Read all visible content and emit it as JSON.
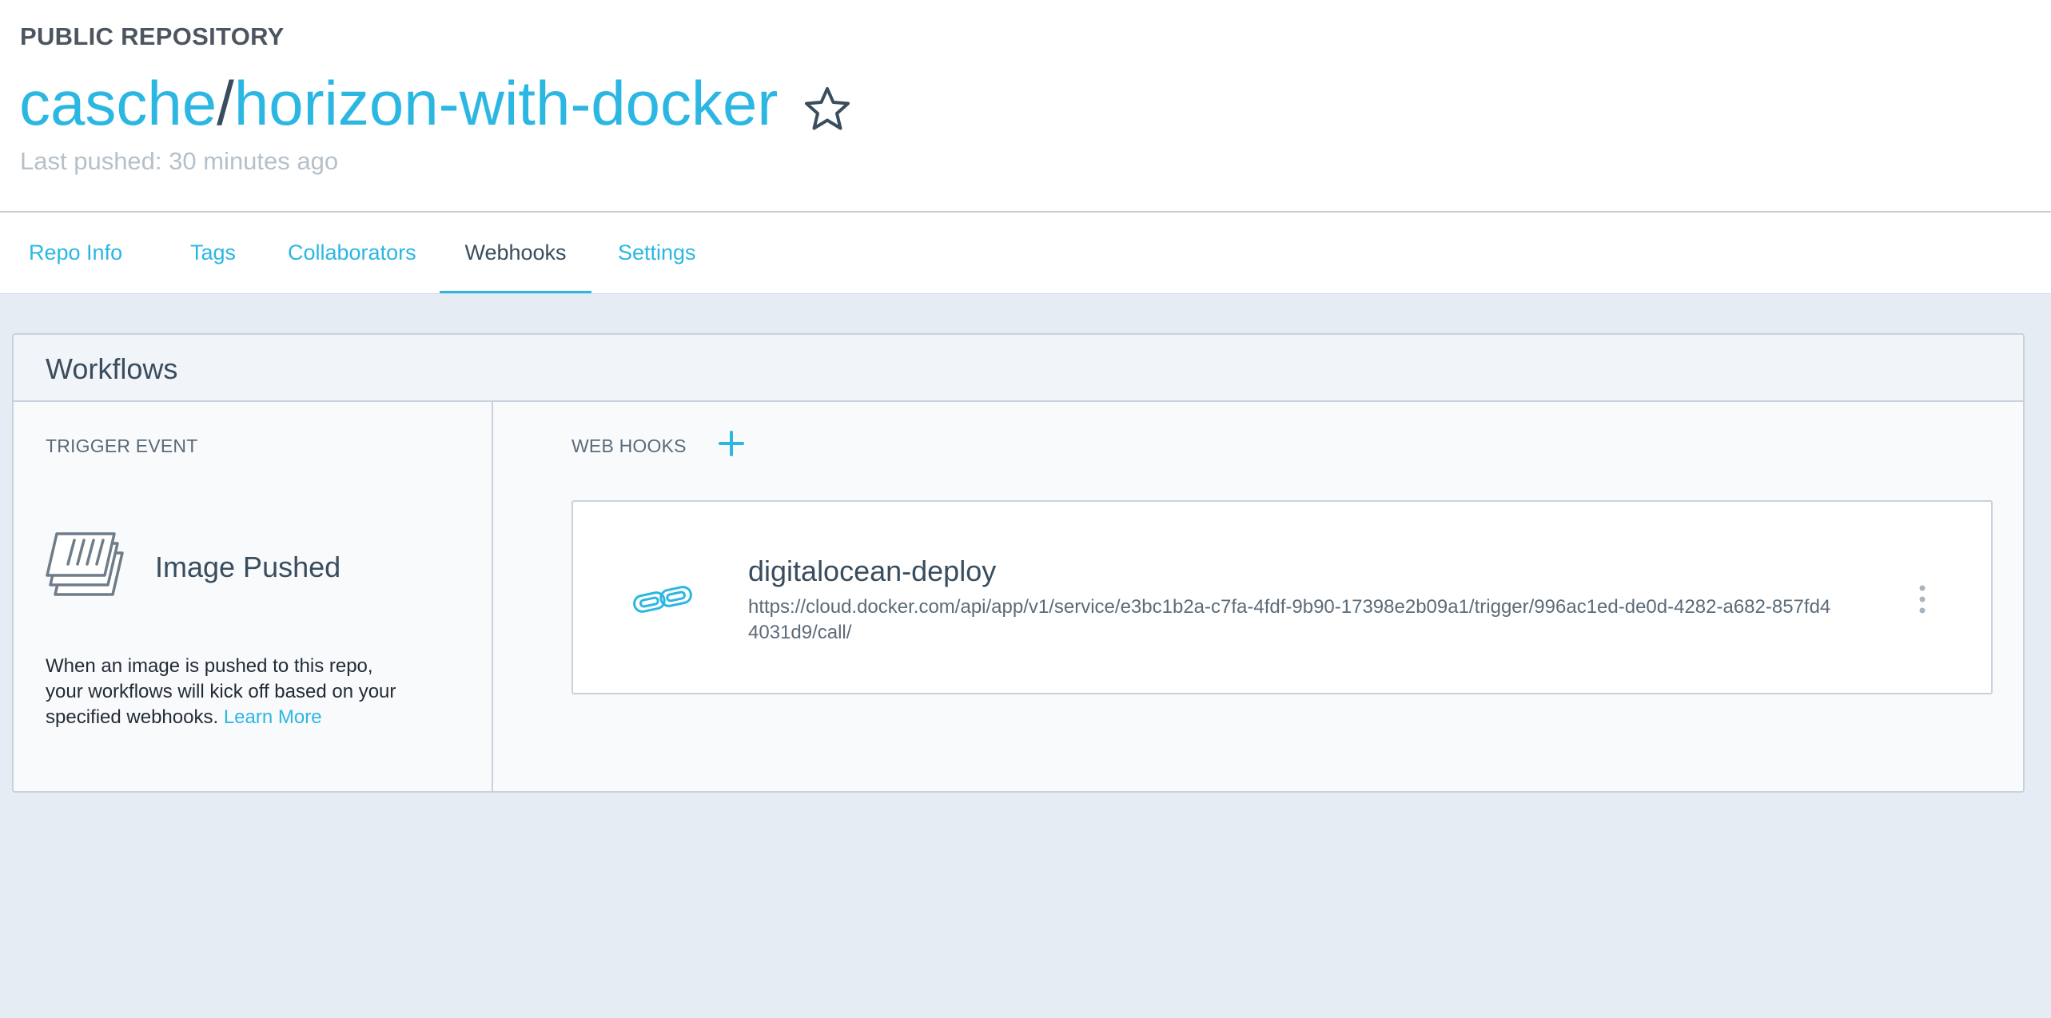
{
  "header": {
    "visibility": "PUBLIC REPOSITORY",
    "namespace": "casche",
    "separator": "/",
    "repo_name": "horizon-with-docker",
    "last_pushed": "Last pushed: 30 minutes ago",
    "star_icon": "star-outline-icon"
  },
  "tabs": [
    {
      "label": "Repo Info",
      "active": false
    },
    {
      "label": "Tags",
      "active": false
    },
    {
      "label": "Collaborators",
      "active": false
    },
    {
      "label": "Webhooks",
      "active": true
    },
    {
      "label": "Settings",
      "active": false
    }
  ],
  "workflows": {
    "title": "Workflows",
    "trigger": {
      "label": "TRIGGER EVENT",
      "icon": "layers-icon",
      "name": "Image Pushed",
      "description": "When an image is pushed to this repo, your workflows will kick off based on your specified webhooks.",
      "learn_more": "Learn More"
    },
    "webhooks": {
      "label": "WEB HOOKS",
      "add_icon": "plus-icon",
      "items": [
        {
          "icon": "link-icon",
          "name": "digitalocean-deploy",
          "url": "https://cloud.docker.com/api/app/v1/service/e3bc1b2a-c7fa-4fdf-9b90-17398e2b09a1/trigger/996ac1ed-de0d-4282-a682-857fd44031d9/call/",
          "menu_icon": "more-vertical-icon"
        }
      ]
    }
  },
  "colors": {
    "accent": "#2cb7e3",
    "text_dark": "#394d5e",
    "muted": "#b6c0c9",
    "background": "#e5ecf4"
  }
}
